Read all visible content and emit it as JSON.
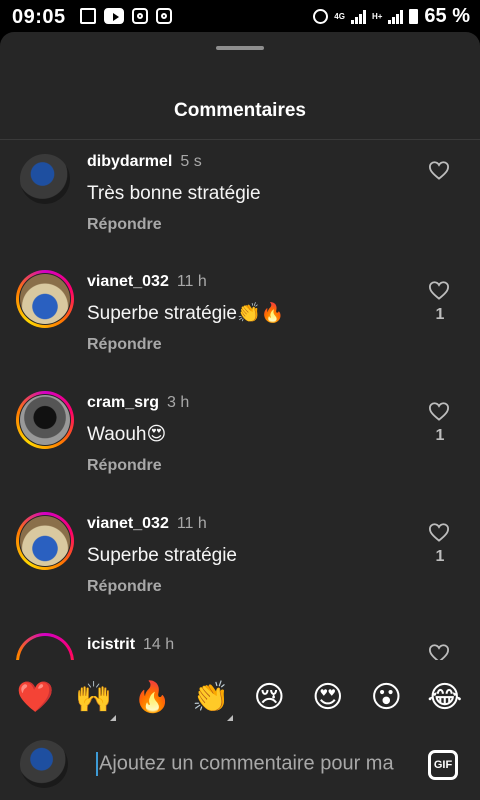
{
  "status_bar": {
    "time": "09:05",
    "battery_label": "65 %",
    "network_4g": "4G",
    "network_h": "H+",
    "icons": [
      "photo-icon",
      "youtube-icon",
      "instagram-icon",
      "instagram-icon"
    ]
  },
  "sheet": {
    "title": "Commentaires"
  },
  "comments": [
    {
      "username": "dibydarmel",
      "time": "5 s",
      "text": "Très bonne stratégie",
      "reply": "Répondre",
      "likes": "",
      "story_ring": false
    },
    {
      "username": "vianet_032",
      "time": "11 h",
      "text": "Superbe stratégie👏🔥",
      "reply": "Répondre",
      "likes": "1",
      "story_ring": true
    },
    {
      "username": "cram_srg",
      "time": "3 h",
      "text": "Waouh😍",
      "reply": "Répondre",
      "likes": "1",
      "story_ring": true
    },
    {
      "username": "vianet_032",
      "time": "11 h",
      "text": "Superbe stratégie",
      "reply": "Répondre",
      "likes": "1",
      "story_ring": true
    },
    {
      "username": "icistrit",
      "time": "14 h",
      "text": "",
      "reply": "",
      "likes": "",
      "story_ring": true
    }
  ],
  "emoji_bar": [
    "❤️",
    "🙌",
    "🔥",
    "👏",
    "😢",
    "😍",
    "😮",
    "😂"
  ],
  "composer": {
    "placeholder": "Ajoutez un commentaire pour ma",
    "gif_label": "GIF"
  },
  "colors": {
    "sheet_bg": "#262626",
    "story_ring_start": "#d300c5",
    "story_ring_end": "#ffd600",
    "caret": "#3d9bd6"
  }
}
